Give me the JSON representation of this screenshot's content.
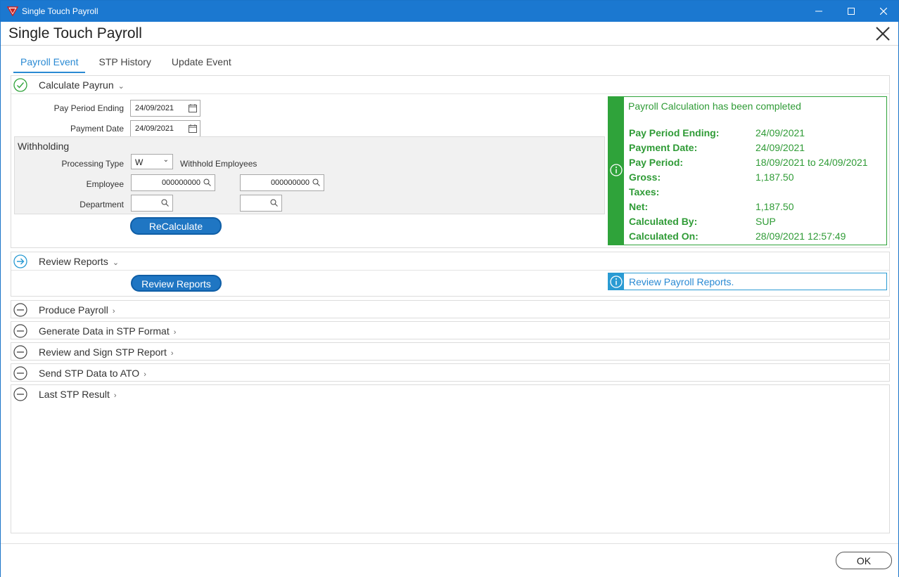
{
  "window": {
    "title": "Single Touch Payroll"
  },
  "header": {
    "title": "Single Touch Payroll"
  },
  "tabs": [
    {
      "label": "Payroll Event",
      "active": true
    },
    {
      "label": "STP History",
      "active": false
    },
    {
      "label": "Update Event",
      "active": false
    }
  ],
  "calculate": {
    "heading": "Calculate Payrun",
    "pay_period_ending_label": "Pay Period Ending",
    "pay_period_ending_value": "24/09/2021",
    "payment_date_label": "Payment Date",
    "payment_date_value": "24/09/2021",
    "withholding": {
      "title": "Withholding",
      "processing_type_label": "Processing Type",
      "processing_type_value": "W",
      "processing_type_desc": "Withhold Employees",
      "employee_label": "Employee",
      "employee_from": "000000000",
      "employee_to": "000000000",
      "department_label": "Department",
      "department_from": "",
      "department_to": ""
    },
    "recalculate_label": "ReCalculate",
    "status": {
      "message": "Payroll Calculation has been completed",
      "rows": [
        {
          "key": "Pay Period Ending:",
          "value": "24/09/2021"
        },
        {
          "key": "Payment Date:",
          "value": "24/09/2021"
        },
        {
          "key": "Pay Period:",
          "value": "18/09/2021 to 24/09/2021"
        },
        {
          "key": "Gross:",
          "value": "1,187.50"
        },
        {
          "key": "Taxes:",
          "value": ""
        },
        {
          "key": "Net:",
          "value": "1,187.50"
        },
        {
          "key": "Calculated By:",
          "value": "SUP"
        },
        {
          "key": "Calculated On:",
          "value": "28/09/2021 12:57:49"
        }
      ],
      "color": "#2fa33a"
    }
  },
  "review": {
    "heading": "Review Reports",
    "button_label": "Review Reports",
    "info_message": "Review Payroll Reports.",
    "color": "#2a9bd3"
  },
  "steps": [
    {
      "label": "Produce Payroll"
    },
    {
      "label": "Generate Data in STP Format"
    },
    {
      "label": "Review and Sign STP Report"
    },
    {
      "label": "Send STP Data to ATO"
    },
    {
      "label": "Last STP Result"
    }
  ],
  "footer": {
    "ok_label": "OK"
  },
  "colors": {
    "titlebar": "#1b78d0",
    "accent": "#2a8ad3",
    "primary_button": "#1f76c3"
  }
}
